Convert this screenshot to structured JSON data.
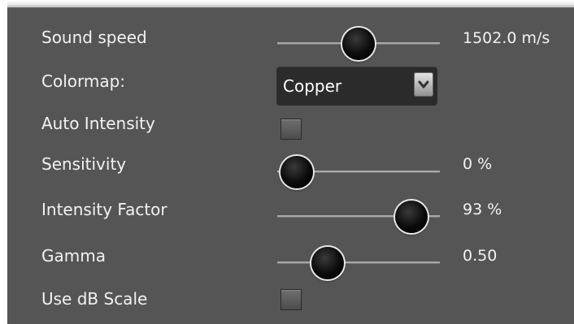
{
  "settings": {
    "sound_speed": {
      "label": "Sound speed",
      "value_text": "1502.0 m/s",
      "level": 0.5
    },
    "colormap": {
      "label": "Colormap:",
      "selected": "Copper"
    },
    "auto_intensity": {
      "label": "Auto Intensity",
      "checked": false
    },
    "sensitivity": {
      "label": "Sensitivity",
      "value_text": "0 %",
      "level": 0.0
    },
    "intensity_factor": {
      "label": "Intensity Factor",
      "value_text": "93 %",
      "level": 0.93
    },
    "gamma": {
      "label": "Gamma",
      "value_text": "0.50",
      "level": 0.25
    },
    "use_db_scale": {
      "label": "Use dB Scale",
      "checked": false
    }
  },
  "icons": {
    "dropdown": "chevron-down-icon",
    "slider_thumb": "circle-knob"
  },
  "colors": {
    "panel_background": "#555555",
    "text": "#f2f2f2",
    "dropdown_background": "#2b2b2b"
  }
}
